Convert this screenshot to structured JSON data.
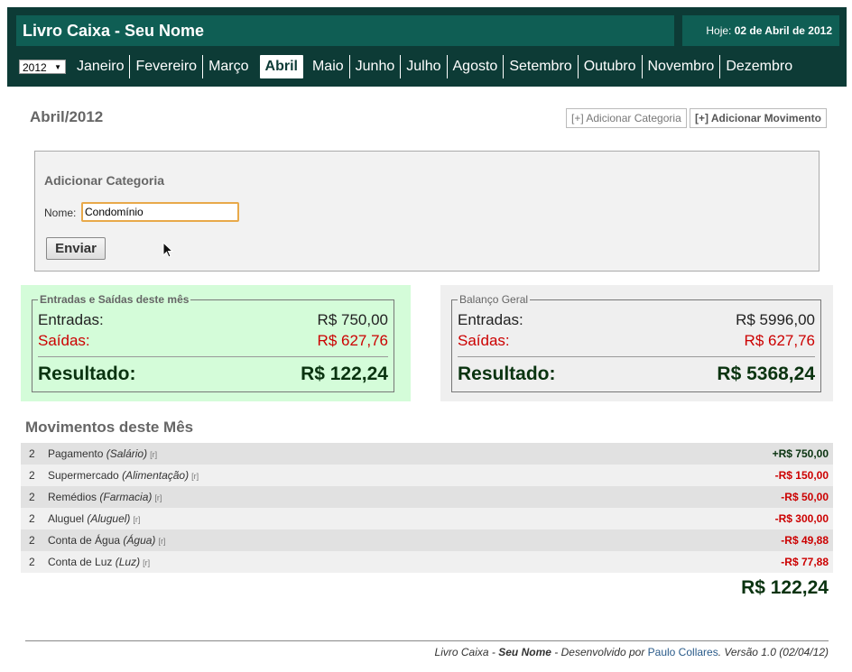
{
  "app": {
    "title": "Livro Caixa - Seu Nome",
    "today_prefix": "Hoje:",
    "today_date": "02 de Abril de 2012"
  },
  "nav": {
    "year": "2012",
    "months": [
      "Janeiro",
      "Fevereiro",
      "Março",
      "Abril",
      "Maio",
      "Junho",
      "Julho",
      "Agosto",
      "Setembro",
      "Outubro",
      "Novembro",
      "Dezembro"
    ],
    "active_month": "Abril"
  },
  "page": {
    "title": "Abril/2012",
    "add_category_label": "[+] Adicionar Categoria",
    "add_movement_label": "[+] Adicionar Movimento"
  },
  "form": {
    "title": "Adicionar Categoria",
    "name_label": "Nome:",
    "name_value": "Condomínio",
    "submit_label": "Enviar"
  },
  "month_summary": {
    "legend": "Entradas e Saídas deste mês",
    "in_label": "Entradas:",
    "in_value": "R$ 750,00",
    "out_label": "Saídas:",
    "out_value": "R$ 627,76",
    "result_label": "Resultado:",
    "result_value": "R$ 122,24"
  },
  "general_summary": {
    "legend": "Balanço Geral",
    "in_label": "Entradas:",
    "in_value": "R$ 5996,00",
    "out_label": "Saídas:",
    "out_value": "R$ 627,76",
    "result_label": "Resultado:",
    "result_value": "R$ 5368,24"
  },
  "movements": {
    "title": "Movimentos deste Mês",
    "rows": [
      {
        "day": "2",
        "name": "Pagamento",
        "category": "(Salário)",
        "r": "[r]",
        "value": "+R$ 750,00",
        "positive": true
      },
      {
        "day": "2",
        "name": "Supermercado",
        "category": "(Alimentação)",
        "r": "[r]",
        "value": "-R$ 150,00",
        "positive": false
      },
      {
        "day": "2",
        "name": "Remédios",
        "category": "(Farmacia)",
        "r": "[r]",
        "value": "-R$ 50,00",
        "positive": false
      },
      {
        "day": "2",
        "name": "Aluguel",
        "category": "(Aluguel)",
        "r": "[r]",
        "value": "-R$ 300,00",
        "positive": false
      },
      {
        "day": "2",
        "name": "Conta de Água",
        "category": "(Água)",
        "r": "[r]",
        "value": "-R$ 49,88",
        "positive": false
      },
      {
        "day": "2",
        "name": "Conta de Luz",
        "category": "(Luz)",
        "r": "[r]",
        "value": "-R$ 77,88",
        "positive": false
      }
    ],
    "total": "R$ 122,24"
  },
  "footer": {
    "app_name": "Livro Caixa",
    "sep1": " - ",
    "owner": "Seu Nome",
    "dev_text": " - Desenvolvido por ",
    "author": "Paulo Collares",
    "version": ". Versão 1.0 (02/04/12)"
  },
  "colors": {
    "header_bg": "#0d3b36",
    "header_panel": "#0f5e54",
    "positive": "#0a3310",
    "negative": "#cc0000",
    "month_summary_bg": "#d4fcd9"
  }
}
